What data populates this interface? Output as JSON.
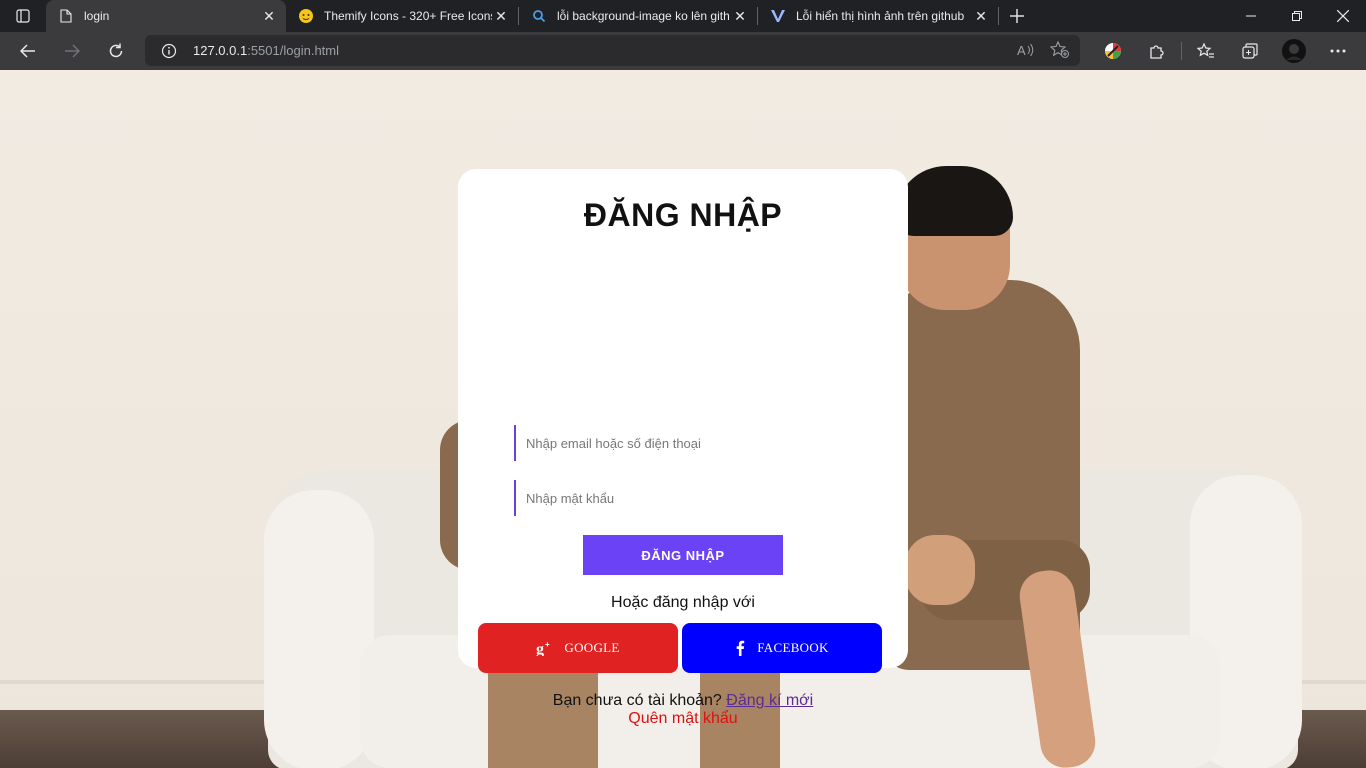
{
  "browser": {
    "tabs": [
      {
        "title": "login",
        "favicon": "page-icon",
        "active": true
      },
      {
        "title": "Themify Icons - 320+ Free Icons",
        "favicon": "themify-emoji-icon",
        "active": false
      },
      {
        "title": "lỗi background-image ko lên gith",
        "favicon": "search-icon",
        "active": false
      },
      {
        "title": "Lỗi hiển thị hình ảnh trên github",
        "favicon": "v-logo-icon",
        "active": false
      }
    ],
    "address": {
      "host": "127.0.0.1",
      "rest": ":5501/login.html"
    }
  },
  "login": {
    "title": "ĐĂNG NHẬP",
    "email_placeholder": "Nhập email hoặc số điện thoại",
    "password_placeholder": "Nhập mật khẩu",
    "submit_label": "ĐĂNG NHẬP",
    "or_text": "Hoặc đăng nhập với",
    "google_label": "GOOGLE",
    "facebook_label": "FACEBOOK",
    "no_account_text": "Bạn chưa có tài khoản?",
    "signup_link": "Đăng kí mới",
    "forgot_link": "Quên mật khẩu"
  },
  "colors": {
    "accent": "#6b42f5",
    "google": "#e02222",
    "facebook": "#0000ff",
    "forgot": "#e01010"
  }
}
